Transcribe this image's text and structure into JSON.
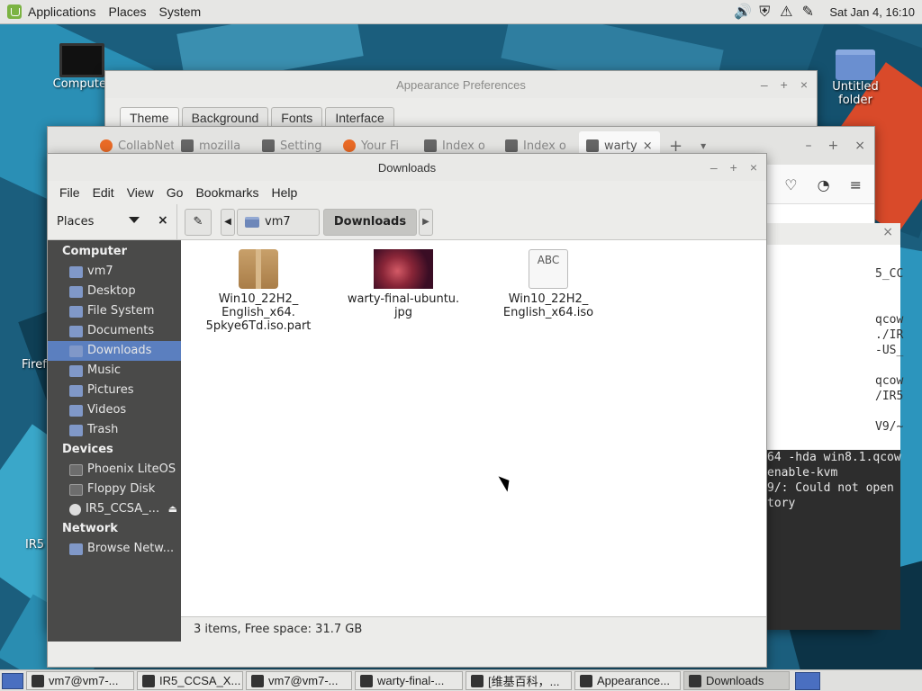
{
  "top_panel": {
    "menus": [
      "Applications",
      "Places",
      "System"
    ],
    "clock": "Sat Jan  4, 16:10"
  },
  "desktop": {
    "icons": [
      {
        "label": "Computer"
      },
      {
        "label": "Untitled folder"
      },
      {
        "label": "Firef"
      },
      {
        "label": "IR5"
      }
    ]
  },
  "appearance": {
    "title": "Appearance Preferences",
    "tabs": [
      "Theme",
      "Background",
      "Fonts",
      "Interface"
    ]
  },
  "firefox": {
    "tabs": [
      "CollabNet",
      "mozilla",
      "Setting",
      "Your Fi",
      "Index o",
      "Index o",
      "warty"
    ]
  },
  "terminal": {
    "close": "×",
    "lines": [
      "",
      "5_CC",
      "",
      "",
      "qcow",
      "./IR",
      "-US_",
      "",
      "qcow",
      "/IR5",
      "",
      "V9/~",
      "",
      "64 -hda win8.1.qcow",
      "enable-kvm",
      "9/: Could not open",
      "tory"
    ]
  },
  "downloads": {
    "title": "Downloads",
    "menu": [
      "File",
      "Edit",
      "View",
      "Go",
      "Bookmarks",
      "Help"
    ],
    "places_label": "Places",
    "breadcrumbs": [
      "vm7",
      "Downloads"
    ],
    "sidebar": {
      "sections": [
        {
          "heading": "Computer",
          "items": [
            "vm7",
            "Desktop",
            "File System",
            "Documents",
            "Downloads",
            "Music",
            "Pictures",
            "Videos",
            "Trash"
          ]
        },
        {
          "heading": "Devices",
          "items": [
            "Phoenix LiteOS",
            "Floppy Disk",
            "IR5_CCSA_..."
          ]
        },
        {
          "heading": "Network",
          "items": [
            "Browse Netw..."
          ]
        }
      ],
      "selected": "Downloads"
    },
    "files": [
      {
        "name_line1": "Win10_22H2_",
        "name_line2": "English_x64.",
        "name_line3": "5pkye6Td.iso.part"
      },
      {
        "name_line1": "warty-final-ubuntu.",
        "name_line2": "jpg",
        "name_line3": ""
      },
      {
        "name_line1": "Win10_22H2_",
        "name_line2": "English_x64.iso",
        "name_line3": ""
      }
    ],
    "doc_thumb_text": "ABC",
    "status": "3 items, Free space: 31.7 GB"
  },
  "taskbar": {
    "tasks": [
      "vm7@vm7-...",
      "IR5_CCSA_X...",
      "vm7@vm7-...",
      "warty-final-...",
      "[维基百科，...",
      "Appearance...",
      "Downloads"
    ],
    "active": "Downloads"
  }
}
